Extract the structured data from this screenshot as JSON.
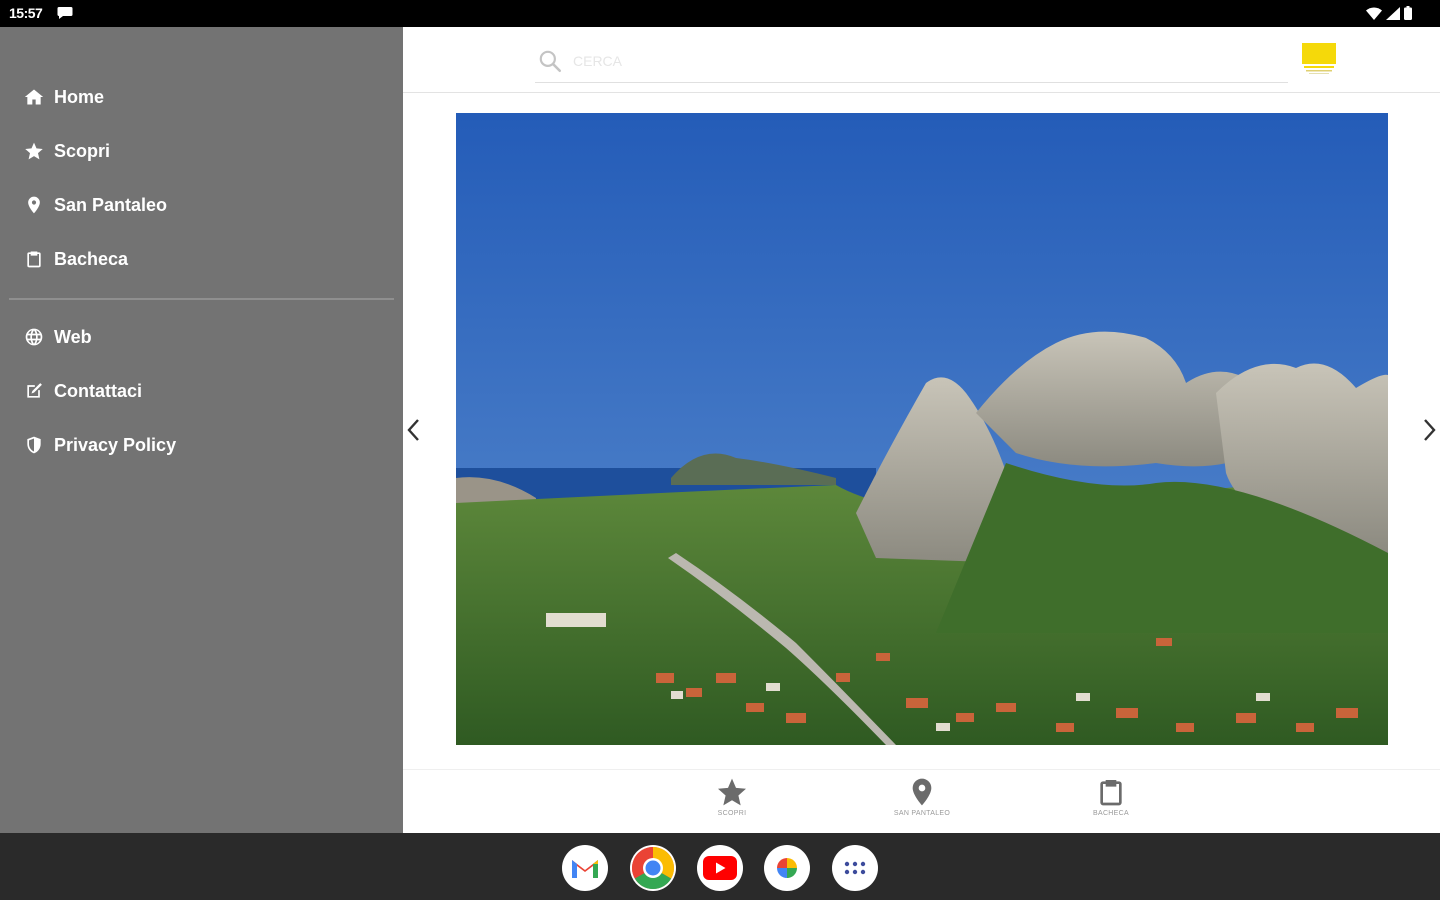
{
  "status_bar": {
    "time": "15:57"
  },
  "drawer": {
    "items": [
      {
        "label": "Home",
        "icon": "home-icon"
      },
      {
        "label": "Scopri",
        "icon": "star-icon"
      },
      {
        "label": "San Pantaleo",
        "icon": "map-pin-icon"
      },
      {
        "label": "Bacheca",
        "icon": "clipboard-icon"
      },
      {
        "label": "Web",
        "icon": "globe-icon"
      },
      {
        "label": "Contattaci",
        "icon": "edit-icon"
      },
      {
        "label": "Privacy Policy",
        "icon": "shield-icon"
      }
    ]
  },
  "header": {
    "search_placeholder": "CERCA"
  },
  "bottom_nav": [
    {
      "label": "SCOPRI",
      "icon": "star-icon"
    },
    {
      "label": "SAN PANTALEO",
      "icon": "map-pin-icon"
    },
    {
      "label": "BACHECA",
      "icon": "clipboard-icon"
    }
  ],
  "taskbar": {
    "apps": [
      "gmail-icon",
      "chrome-icon",
      "youtube-icon",
      "photos-icon",
      "app-drawer-icon"
    ]
  },
  "colors": {
    "drawer_bg": "#737373",
    "logo_yellow": "#f5d90a",
    "sky": "#2f63b4",
    "taskbar_bg": "#2a2a2a"
  }
}
